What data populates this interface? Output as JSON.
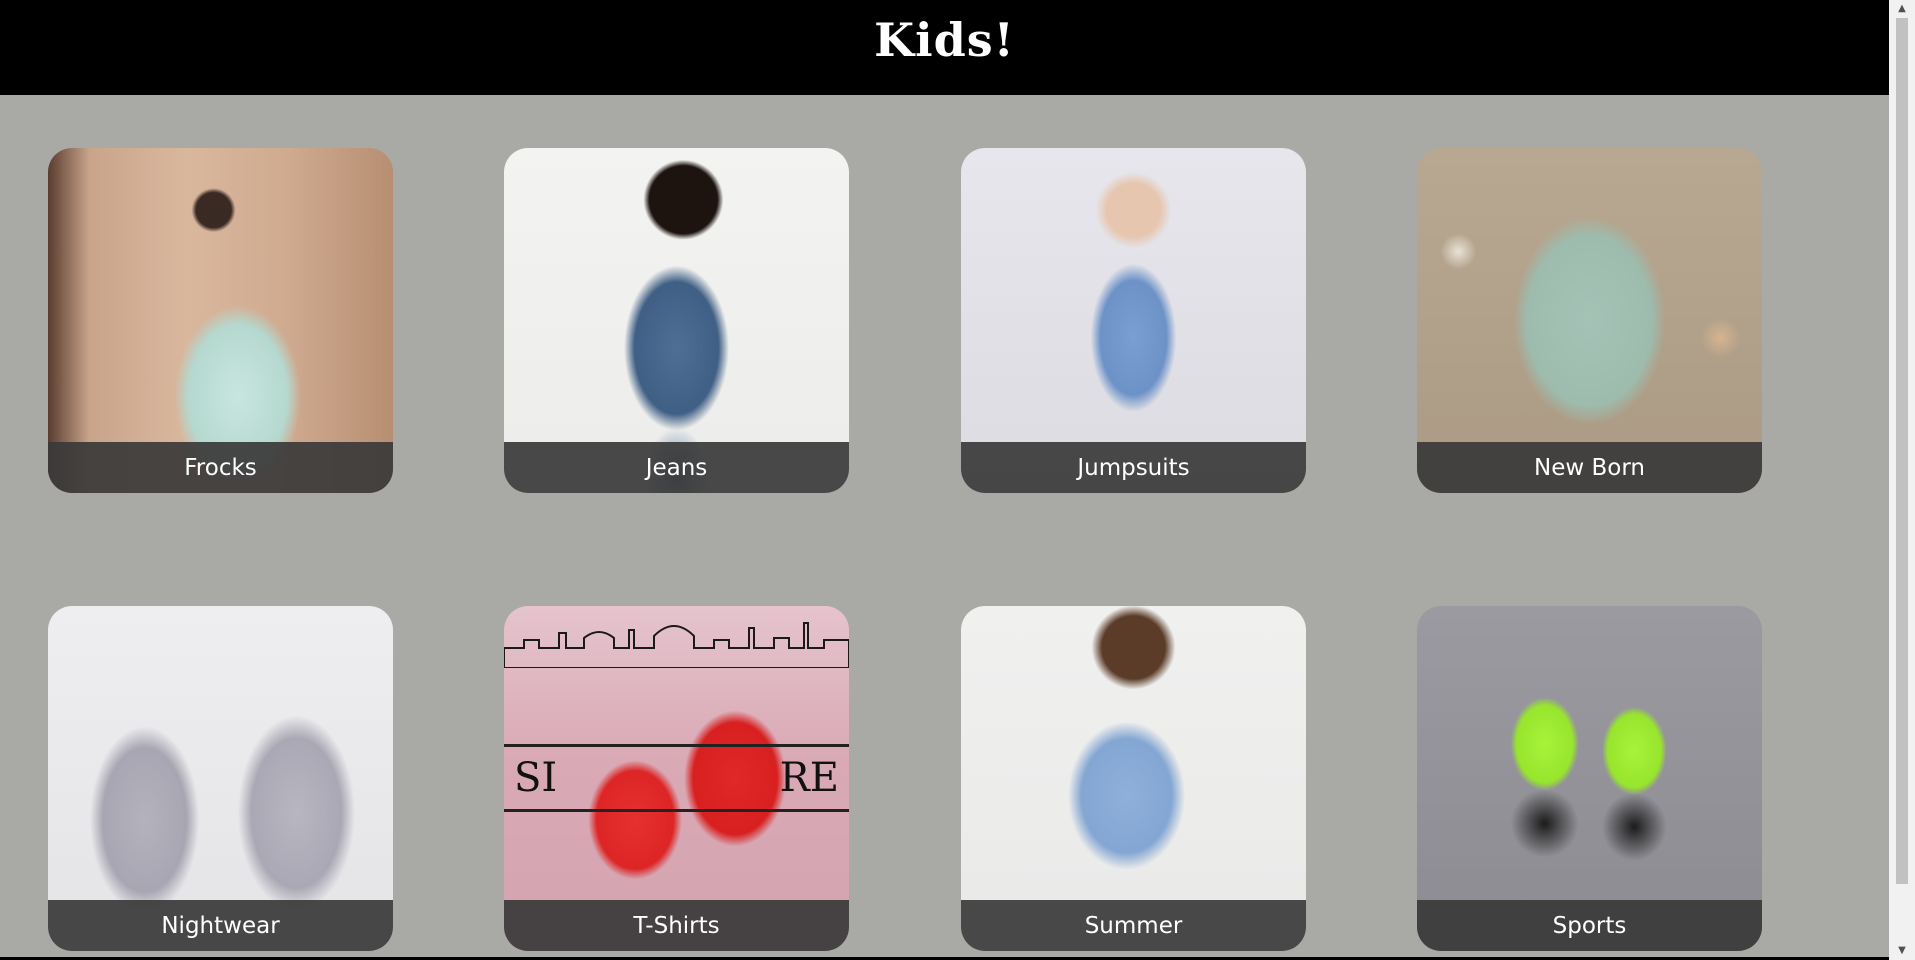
{
  "header": {
    "title": "Kids!"
  },
  "categories": [
    {
      "label": "Frocks"
    },
    {
      "label": "Jeans"
    },
    {
      "label": "Jumpsuits"
    },
    {
      "label": "New Born"
    },
    {
      "label": "Nightwear"
    },
    {
      "label": "T-Shirts"
    },
    {
      "label": "Summer"
    },
    {
      "label": "Sports"
    }
  ],
  "tshirts_sign": {
    "left": "SI",
    "right": "RE"
  },
  "icons": {
    "scroll_up": "triangle-up-icon",
    "scroll_down": "triangle-down-icon"
  },
  "colors": {
    "header_bg": "#000000",
    "page_bg": "#a9aaa5",
    "caption_bg": "#3a3a3a"
  }
}
